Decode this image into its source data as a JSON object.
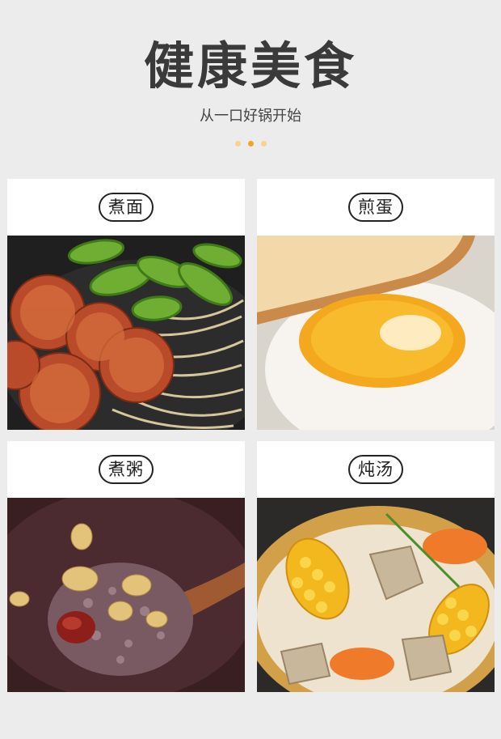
{
  "header": {
    "title": "健康美食",
    "subtitle": "从一口好锅开始",
    "carousel": {
      "count": 3,
      "active_index": 1
    }
  },
  "cards": [
    {
      "label": "煮面",
      "photo": "noodles-with-sausage-and-okra"
    },
    {
      "label": "煎蛋",
      "photo": "fried-egg-with-toast"
    },
    {
      "label": "煮粥",
      "photo": "multigrain-porridge"
    },
    {
      "label": "炖汤",
      "photo": "corn-and-rib-soup"
    }
  ],
  "colors": {
    "background": "#ececec",
    "accent": "#efa624",
    "accent_light": "#f6d48a"
  }
}
